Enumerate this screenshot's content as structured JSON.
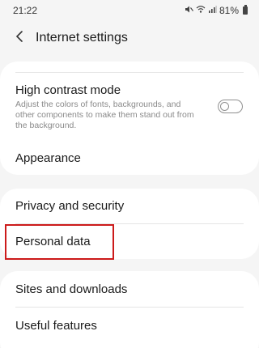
{
  "status_bar": {
    "time": "21:22",
    "battery": "81%",
    "icons": [
      "mute-icon",
      "wifi-icon",
      "signal-icon",
      "battery-icon"
    ]
  },
  "header": {
    "back_icon": "chevron-left-icon",
    "title": "Internet settings"
  },
  "sections": {
    "display": {
      "high_contrast": {
        "title": "High contrast mode",
        "description": "Adjust the colors of fonts, backgrounds, and other components to make them stand out from the background.",
        "enabled": false
      },
      "appearance_label": "Appearance"
    },
    "privacy": {
      "privacy_label": "Privacy and security",
      "personal_data_label": "Personal data"
    },
    "more": {
      "sites_label": "Sites and downloads",
      "useful_label": "Useful features"
    }
  },
  "colors": {
    "background": "#f5f5f5",
    "card": "#ffffff",
    "highlight": "#cc1a1a"
  }
}
